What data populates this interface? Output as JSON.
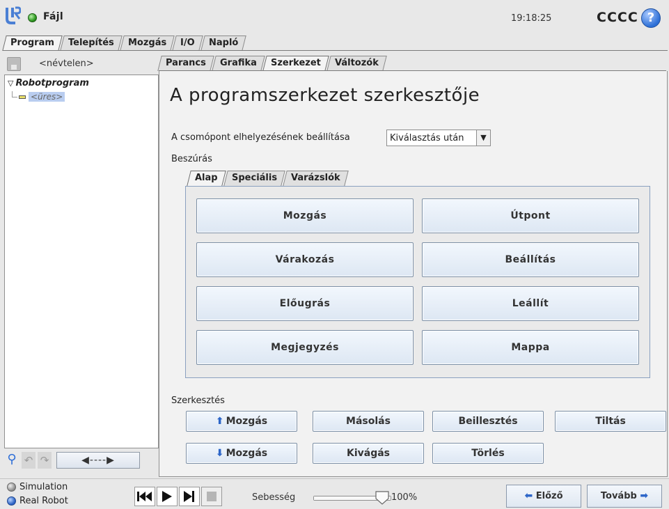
{
  "header": {
    "file_label": "Fájl",
    "time": "19:18:25",
    "robot_name": "CCCC",
    "help_label": "?"
  },
  "main_tabs": [
    {
      "label": "Program",
      "active": true
    },
    {
      "label": "Telepítés",
      "active": false
    },
    {
      "label": "Mozgás",
      "active": false
    },
    {
      "label": "I/O",
      "active": false
    },
    {
      "label": "Napló",
      "active": false
    }
  ],
  "left_panel": {
    "program_name": "<névtelen>",
    "tree_root": "Robotprogram",
    "tree_child": "<üres>",
    "collapse_label": "◀----▶"
  },
  "sub_tabs": [
    {
      "label": "Parancs",
      "active": false
    },
    {
      "label": "Grafika",
      "active": false
    },
    {
      "label": "Szerkezet",
      "active": true
    },
    {
      "label": "Változók",
      "active": false
    }
  ],
  "structure": {
    "title": "A programszerkezet szerkesztője",
    "placement_label": "A csomópont elhelyezésének beállítása",
    "placement_value": "Kiválasztás után",
    "insert_label": "Beszúrás",
    "inner_tabs": [
      {
        "label": "Alap",
        "active": true
      },
      {
        "label": "Speciális",
        "active": false
      },
      {
        "label": "Varázslók",
        "active": false
      }
    ],
    "insert_buttons": [
      "Mozgás",
      "Útpont",
      "Várakozás",
      "Beállítás",
      "Előugrás",
      "Leállít",
      "Megjegyzés",
      "Mappa"
    ],
    "edit_label": "Szerkesztés",
    "edit_buttons": {
      "move_up": "Mozgás",
      "copy": "Másolás",
      "paste": "Beillesztés",
      "suppress": "Tiltás",
      "move_down": "Mozgás",
      "cut": "Kivágás",
      "delete": "Törlés"
    }
  },
  "bottom": {
    "simulation_label": "Simulation",
    "real_robot_label": "Real Robot",
    "speed_label": "Sebesség",
    "speed_value": "100%",
    "speed_fraction": 1.0,
    "prev_label": "Előző",
    "next_label": "Tovább"
  },
  "colors": {
    "accent_blue": "#2d66c8",
    "status_green": "#2f9a22",
    "selection": "#b9cdf0"
  }
}
